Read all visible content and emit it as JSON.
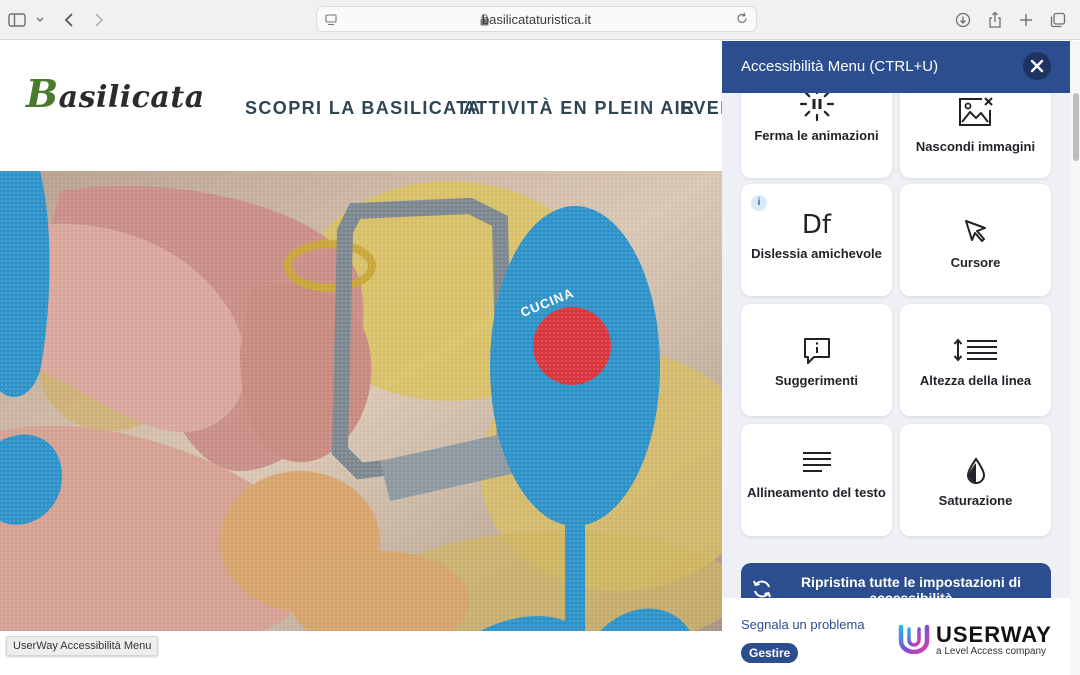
{
  "browser": {
    "url": "basilicataturistica.it",
    "icons": [
      "sidebar-icon",
      "chevron-down-icon",
      "back-icon",
      "forward-icon",
      "reader-icon",
      "lock-icon",
      "reload-icon",
      "download-icon",
      "share-icon",
      "new-tab-icon",
      "tabs-overview-icon"
    ]
  },
  "site": {
    "logo": {
      "initial": "B",
      "rest": "asilicata"
    },
    "nav": [
      "SCOPRI LA BASILICATA",
      "ATTIVITÀ EN PLEIN AIR",
      "EVEN"
    ],
    "hero_badge": "CUCINA",
    "tooltip": "UserWay Accessibilità Menu"
  },
  "accessibility_panel": {
    "title": "Accessibilità Menu (CTRL+U)",
    "tiles": [
      {
        "label": "Ferma le animazioni",
        "icon": "pause-animation-icon"
      },
      {
        "label": "Nascondi immagini",
        "icon": "hide-images-icon"
      },
      {
        "label": "Dislessia amichevole",
        "icon": "dyslexia-df-icon",
        "info": "i"
      },
      {
        "label": "Cursore",
        "icon": "cursor-icon"
      },
      {
        "label": "Suggerimenti",
        "icon": "tooltip-icon"
      },
      {
        "label": "Altezza della linea",
        "icon": "line-height-icon"
      },
      {
        "label": "Allineamento del testo",
        "icon": "text-align-icon"
      },
      {
        "label": "Saturazione",
        "icon": "saturation-drop-icon"
      }
    ],
    "reset_label": "Ripristina tutte le impostazioni di accessibilità",
    "report_link": "Segnala un problema",
    "manage_label": "Gestire",
    "brand": "USERWAY",
    "brand_tagline": "a Level Access company"
  },
  "colors": {
    "panel_blue": "#2c4d8e",
    "hero_blue": "#2d93c9",
    "hero_red": "#d9373d",
    "nav_text": "#2e4653",
    "logo_green": "#4a7a2c"
  }
}
